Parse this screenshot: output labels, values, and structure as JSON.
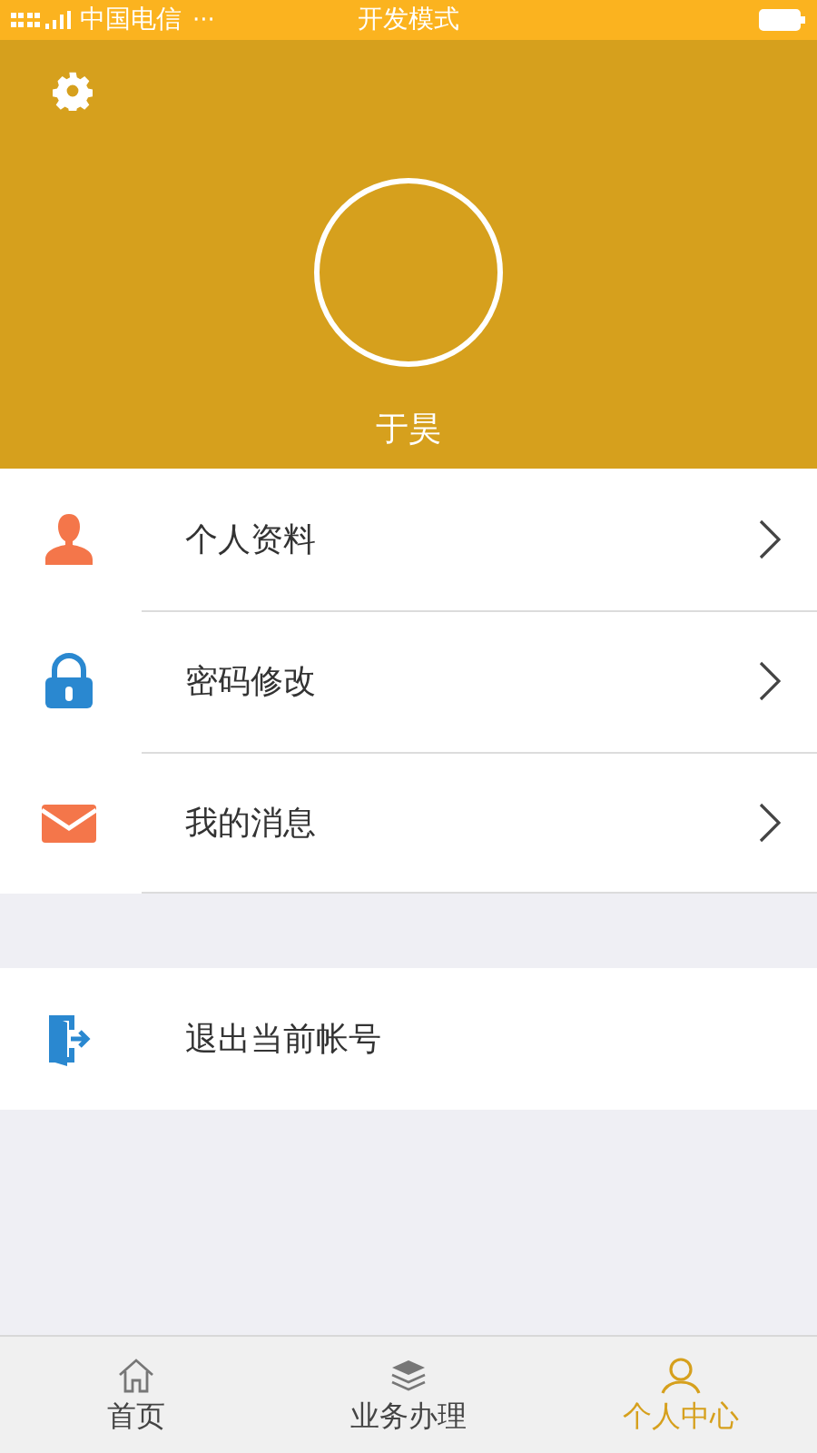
{
  "status_bar": {
    "carrier": "中国电信",
    "dots": "···",
    "title": "开发模式"
  },
  "profile": {
    "name": "于昊"
  },
  "menu": [
    {
      "kind": "person",
      "label": "个人资料"
    },
    {
      "kind": "lock",
      "label": "密码修改"
    },
    {
      "kind": "mail",
      "label": "我的消息"
    }
  ],
  "logout": {
    "kind": "exit",
    "label": "退出当前帐号"
  },
  "tabs": [
    {
      "kind": "home",
      "label": "首页",
      "selected": false
    },
    {
      "kind": "layers",
      "label": "业务办理",
      "selected": false
    },
    {
      "kind": "user",
      "label": "个人中心",
      "selected": true
    }
  ]
}
